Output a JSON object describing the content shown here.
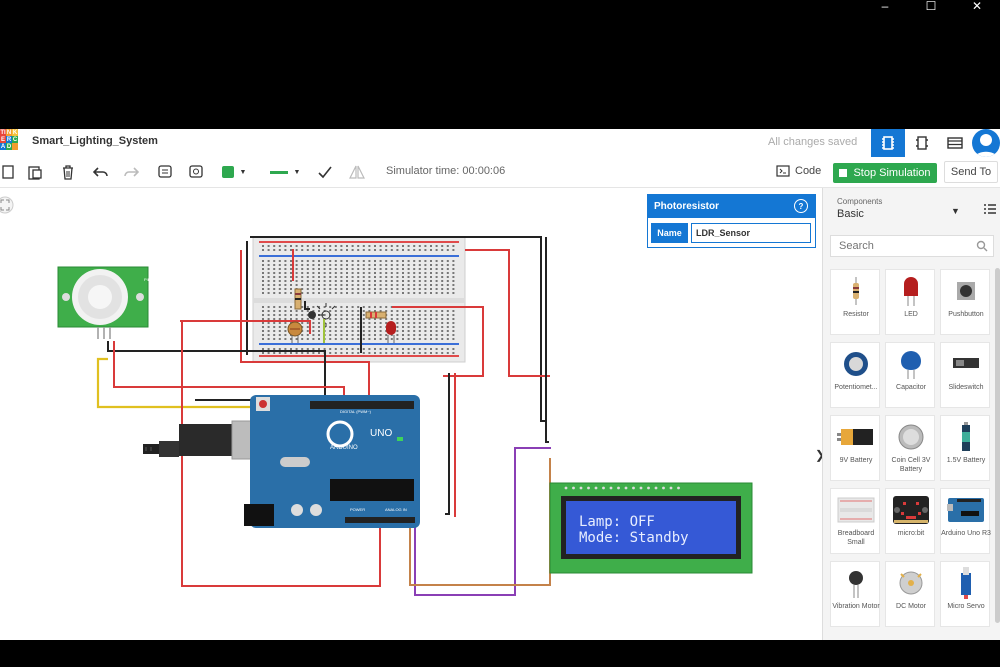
{
  "window": {
    "minimize": "–",
    "maximize": "☐",
    "close": "✕"
  },
  "logo": [
    "TI",
    "N",
    "K",
    "E",
    "R",
    "C",
    "A",
    "D",
    ""
  ],
  "header": {
    "title": "Smart_Lighting_System",
    "saved": "All changes saved"
  },
  "toolbar": {
    "sim_time": "Simulator time: 00:00:06",
    "code": "Code",
    "stop": "Stop Simulation",
    "send_to": "Send To",
    "color_accent": "#2ea84f"
  },
  "inspector": {
    "title": "Photoresistor",
    "help": "?",
    "name_label": "Name",
    "name_value": "LDR_Sensor"
  },
  "panel": {
    "components_label": "Components",
    "components_value": "Basic",
    "search_placeholder": "Search",
    "items": [
      {
        "label": "Resistor",
        "icon": "resistor-icon"
      },
      {
        "label": "LED",
        "icon": "led-icon"
      },
      {
        "label": "Pushbutton",
        "icon": "pushbutton-icon"
      },
      {
        "label": "Potentiomet...",
        "icon": "potentiometer-icon"
      },
      {
        "label": "Capacitor",
        "icon": "capacitor-icon"
      },
      {
        "label": "Slideswitch",
        "icon": "slideswitch-icon"
      },
      {
        "label": "9V Battery",
        "icon": "battery-9v-icon"
      },
      {
        "label": "Coin Cell 3V Battery",
        "icon": "coin-cell-icon"
      },
      {
        "label": "1.5V Battery",
        "icon": "battery-aa-icon"
      },
      {
        "label": "Breadboard Small",
        "icon": "breadboard-icon"
      },
      {
        "label": "micro:bit",
        "icon": "microbit-icon"
      },
      {
        "label": "Arduino Uno R3",
        "icon": "arduino-icon"
      },
      {
        "label": "Vibration Motor",
        "icon": "vibration-motor-icon"
      },
      {
        "label": "DC Motor",
        "icon": "dc-motor-icon"
      },
      {
        "label": "Micro Servo",
        "icon": "micro-servo-icon"
      }
    ]
  },
  "circuit": {
    "lcd_line1": "Lamp: OFF",
    "lcd_line2": "Mode: Standby",
    "arduino_label": "ARDUINO",
    "arduino_model": "UNO",
    "arduino_digital": "DIGITAL (PWM~)",
    "arduino_power": "POWER",
    "arduino_analog": "ANALOG IN",
    "pir_label": "PIR"
  }
}
